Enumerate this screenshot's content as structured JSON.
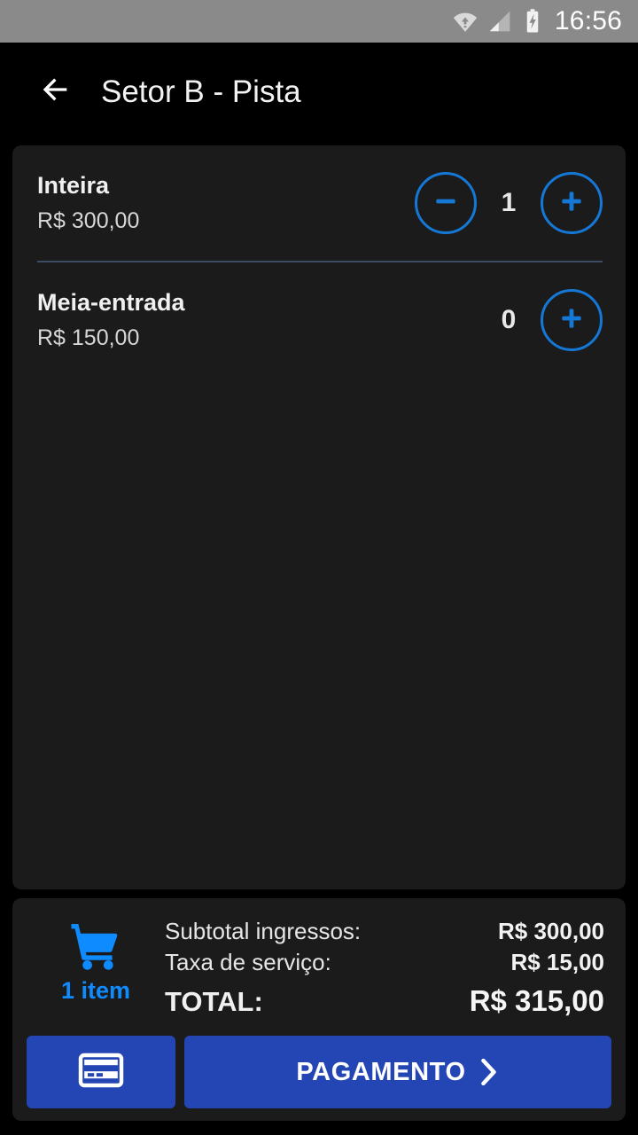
{
  "status_bar": {
    "time": "16:56",
    "icons": [
      "wifi-icon",
      "cellular-signal-icon",
      "battery-charging-icon"
    ],
    "background": "#8a8a8a"
  },
  "app_bar": {
    "back_icon": "arrow-left-icon",
    "title": "Setor B - Pista"
  },
  "theme": {
    "page_background": "#000000",
    "card_background": "#1b1b1b",
    "accent_blue": "#1578d6",
    "cart_blue": "#0d8bff",
    "button_blue": "#2446b4",
    "divider": "#3d4c62"
  },
  "tickets": [
    {
      "name": "Inteira",
      "price": "R$ 300,00",
      "quantity": "1",
      "has_decrement": true,
      "decrement_icon": "minus-circle-icon",
      "increment_icon": "plus-circle-icon"
    },
    {
      "name": "Meia-entrada",
      "price": "R$ 150,00",
      "quantity": "0",
      "has_decrement": false,
      "decrement_icon": "minus-circle-icon",
      "increment_icon": "plus-circle-icon"
    }
  ],
  "summary": {
    "cart_icon": "shopping-cart-icon",
    "item_count_label": "1 item",
    "lines": [
      {
        "label": "Subtotal ingressos:",
        "value": "R$ 300,00"
      },
      {
        "label": "Taxa de serviço:",
        "value": "R$ 15,00"
      }
    ],
    "total": {
      "label": "TOTAL:",
      "value": "R$ 315,00"
    }
  },
  "actions": {
    "card_button": {
      "icon": "credit-card-icon",
      "label": ""
    },
    "payment_button": {
      "label": "PAGAMENTO",
      "icon": "chevron-right-icon"
    }
  }
}
